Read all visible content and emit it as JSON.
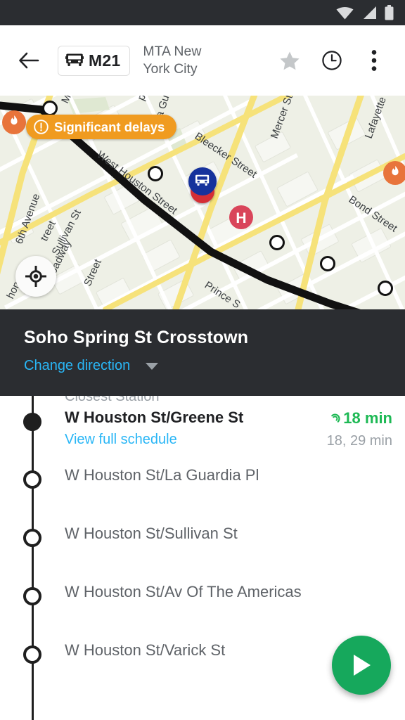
{
  "statusbar": {
    "icons": [
      "wifi-icon",
      "cellular-signal-icon",
      "battery-icon"
    ]
  },
  "appbar": {
    "back_icon": "back-arrow-icon",
    "route_badge": {
      "icon": "bus-icon",
      "label": "M21"
    },
    "agency": "MTA New York City",
    "actions": [
      {
        "name": "favorite-star",
        "icon": "star-icon"
      },
      {
        "name": "schedule-clock",
        "icon": "clock-icon"
      },
      {
        "name": "overflow-menu",
        "icon": "more-vert-icon"
      }
    ]
  },
  "map": {
    "alert_chip": {
      "icon": "warning-icon",
      "text": "Significant delays"
    },
    "my_location_icon": "my-location-icon",
    "vehicle_marker": {
      "icon": "bus-pin-icon"
    },
    "poi_markers": [
      {
        "icon": "hospital-icon",
        "label": "H"
      },
      {
        "icon": "flame-icon"
      },
      {
        "icon": "flame-icon"
      }
    ],
    "street_labels": [
      "6th Avenue",
      "Sullivan St",
      "MacDougal",
      "Thompson",
      "La Guardia Pl",
      "West Houston Street",
      "Bleecker Street",
      "Mercer St",
      "Lafayette",
      "Bond Street",
      "Broadway",
      "Street",
      "Prince St"
    ]
  },
  "direction_panel": {
    "title": "Soho Spring St Crosstown",
    "change_direction": "Change direction",
    "caret_icon": "chevron-down-icon"
  },
  "stops": {
    "section_header": "Closest Station",
    "items": [
      {
        "name": "W Houston St/Greene St",
        "sub_link": "View full schedule",
        "eta": "18 min",
        "eta_live_icon": "live-signal-icon",
        "next_times": "18, 29 min",
        "primary": true
      },
      {
        "name": "W Houston St/La Guardia Pl",
        "primary": false
      },
      {
        "name": "W Houston St/Sullivan St",
        "primary": false
      },
      {
        "name": "W Houston St/Av Of The Americas",
        "primary": false
      },
      {
        "name": "W Houston St/Varick St",
        "primary": false
      }
    ]
  },
  "fab": {
    "icon": "play-icon"
  },
  "colors": {
    "status_bar": "#2b2d31",
    "panel_dark": "#2b2d31",
    "accent_link": "#29b6f6",
    "alert_orange": "#f09b20",
    "eta_green": "#1db954",
    "fab_green": "#16a85c",
    "route_line": "#111111",
    "map_background": "#eef0e6"
  }
}
